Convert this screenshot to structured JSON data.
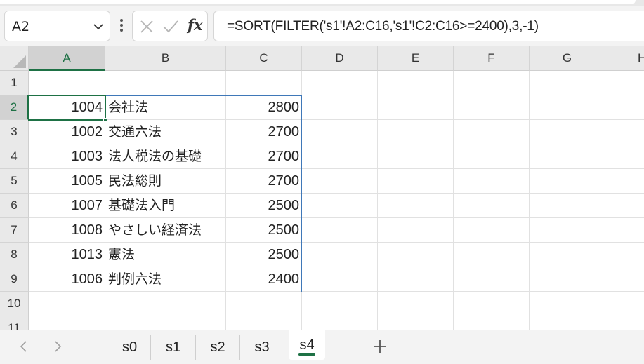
{
  "formula_bar": {
    "name_box": "A2",
    "formula": "=SORT(FILTER('s1'!A2:C16,'s1'!C2:C16>=2400),3,-1)",
    "fx_label": "fx"
  },
  "columns": [
    "A",
    "B",
    "C",
    "D",
    "E",
    "F",
    "G",
    "H"
  ],
  "rows": [
    "1",
    "2",
    "3",
    "4",
    "5",
    "6",
    "7",
    "8",
    "9",
    "10",
    "11"
  ],
  "data_rows": [
    {
      "id": "1004",
      "title": "会社法",
      "price": "2800"
    },
    {
      "id": "1002",
      "title": "交通六法",
      "price": "2700"
    },
    {
      "id": "1003",
      "title": "法人税法の基礎",
      "price": "2700"
    },
    {
      "id": "1005",
      "title": "民法総則",
      "price": "2700"
    },
    {
      "id": "1007",
      "title": "基礎法入門",
      "price": "2500"
    },
    {
      "id": "1008",
      "title": "やさしい経済法",
      "price": "2500"
    },
    {
      "id": "1013",
      "title": "憲法",
      "price": "2500"
    },
    {
      "id": "1006",
      "title": "判例六法",
      "price": "2400"
    }
  ],
  "sheet_tabs": [
    "s0",
    "s1",
    "s2",
    "s3",
    "s4"
  ],
  "active_sheet": "s4",
  "colors": {
    "accent": "#1e7145",
    "spill_border": "#3f78b8"
  }
}
